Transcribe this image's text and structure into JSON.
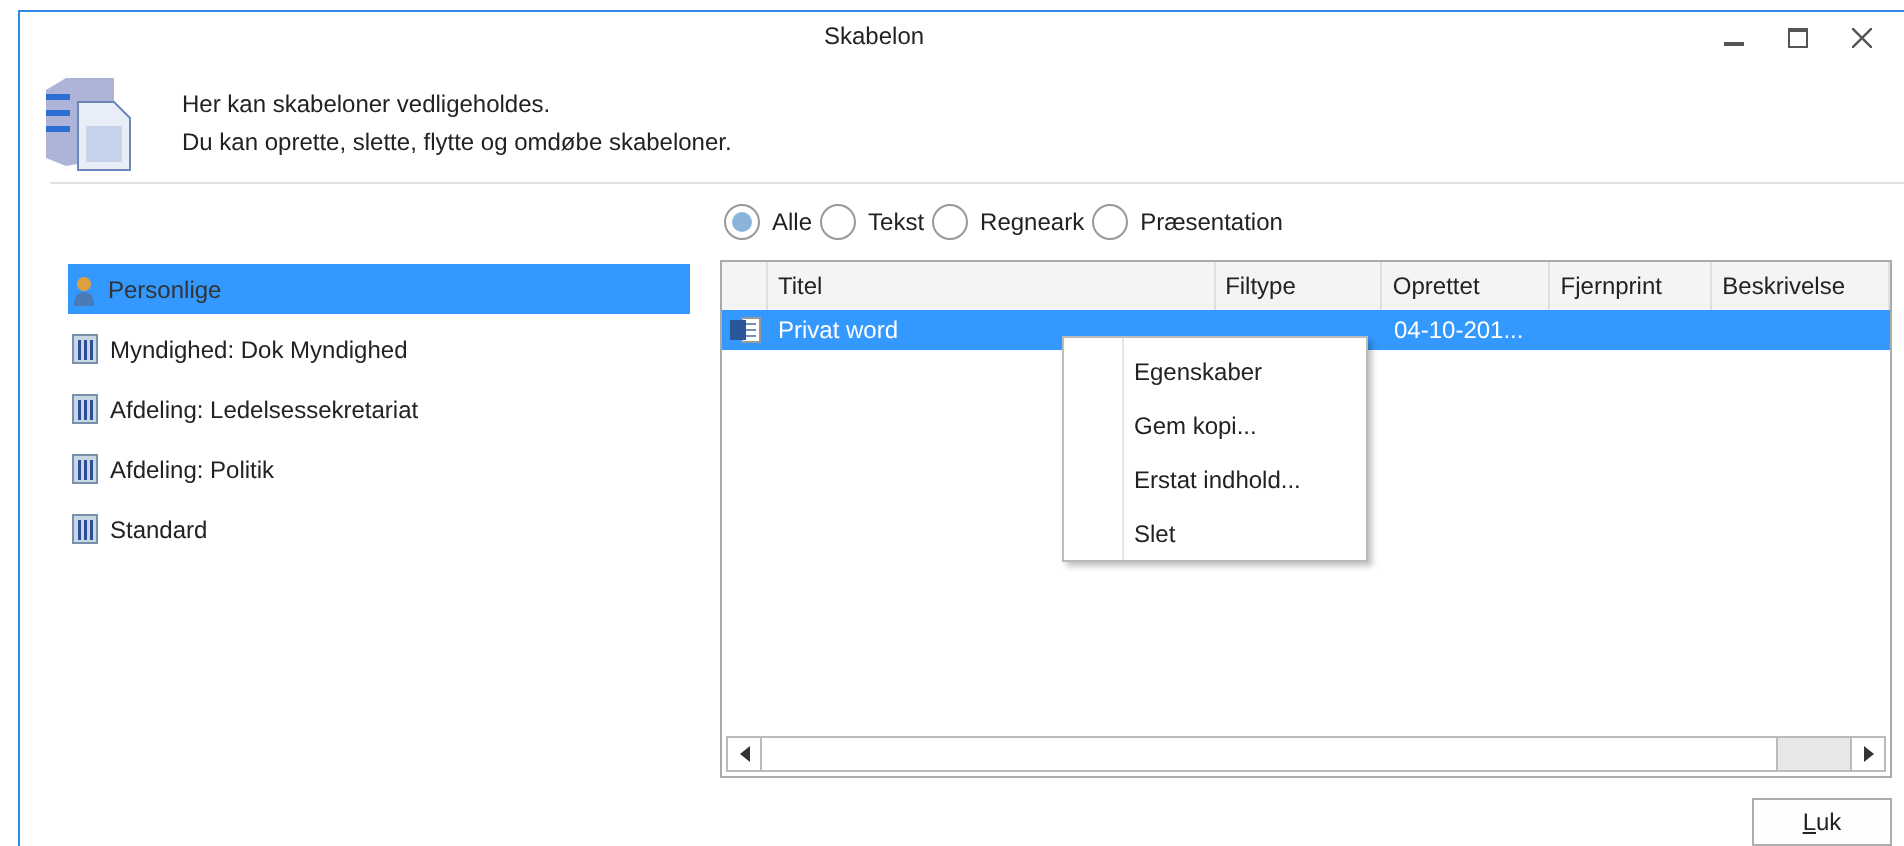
{
  "window": {
    "title": "Skabelon"
  },
  "header": {
    "lines": [
      "Her kan skabeloner vedligeholdes.",
      "Du kan oprette, slette, flytte og omdøbe skabeloner."
    ]
  },
  "sidebar": {
    "items": [
      {
        "label": "Personlige",
        "kind": "person",
        "selected": true
      },
      {
        "label": "Myndighed: Dok Myndighed",
        "kind": "building",
        "selected": false
      },
      {
        "label": "Afdeling: Ledelsessekretariat",
        "kind": "building",
        "selected": false
      },
      {
        "label": "Afdeling: Politik",
        "kind": "building",
        "selected": false
      },
      {
        "label": "Standard",
        "kind": "building",
        "selected": false
      }
    ]
  },
  "filters": [
    {
      "label": "Alle",
      "selected": true
    },
    {
      "label": "Tekst",
      "selected": false
    },
    {
      "label": "Regneark",
      "selected": false
    },
    {
      "label": "Præsentation",
      "selected": false
    }
  ],
  "table": {
    "columns": [
      "Titel",
      "Filtype",
      "Oprettet",
      "Fjernprint",
      "Beskrivelse"
    ],
    "rows": [
      {
        "selected": true,
        "title": "Privat word",
        "created": "04-10-201..."
      }
    ]
  },
  "context_menu": {
    "items": [
      "Egenskaber",
      "Gem kopi...",
      "Erstat indhold...",
      "Slet"
    ]
  },
  "buttons": [
    "Luk"
  ]
}
